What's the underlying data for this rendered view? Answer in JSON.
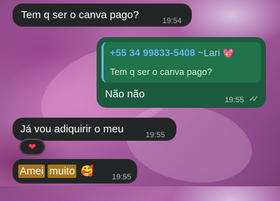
{
  "messages": [
    {
      "direction": "incoming",
      "text": "Tem q ser o canva pago?",
      "time": "19:54"
    },
    {
      "direction": "outgoing",
      "reply_to": {
        "phone": "+55 34 99833-5408",
        "name": "~Lari",
        "name_emoji": "sparkling-heart",
        "text": "Tem q ser o canva pago?"
      },
      "text": "Não não",
      "time": "19:55",
      "status": "read"
    },
    {
      "direction": "incoming",
      "text": "Já vou adiquirir o meu",
      "time": "19:55",
      "reaction": "heart"
    },
    {
      "direction": "incoming",
      "highlighted_words": [
        "Amei",
        "muito"
      ],
      "emoji": "smiling-face-with-hearts",
      "time": "19:55"
    }
  ],
  "colors": {
    "incoming_bubble": "#232626",
    "outgoing_bubble": "#1c5a3d",
    "reply_author": "#61b5ee",
    "highlight": "#a8771f"
  }
}
